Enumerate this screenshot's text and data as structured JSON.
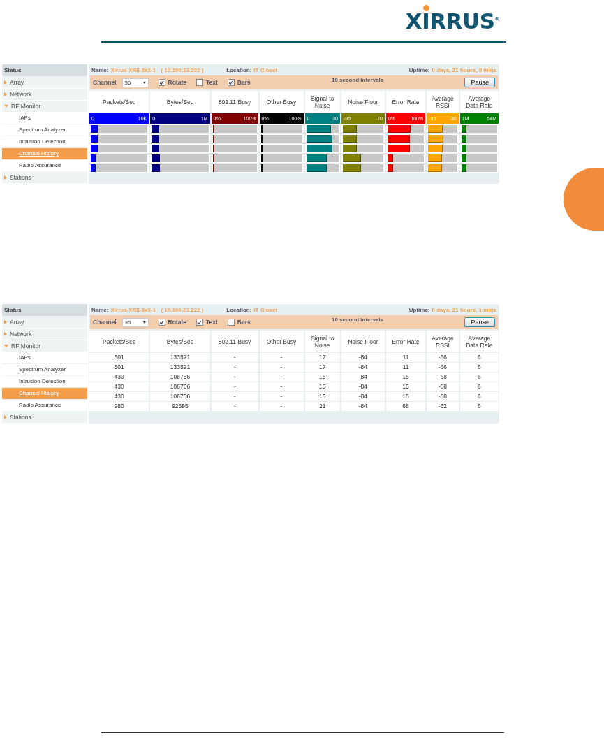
{
  "logo": {
    "text": "XIRRUS",
    "mark": "®"
  },
  "panels": [
    {
      "kind": "bars",
      "sidebar": {
        "title": "Status",
        "items": [
          {
            "label": "Array",
            "kind": "section",
            "expanded": false
          },
          {
            "label": "Network",
            "kind": "section",
            "expanded": false
          },
          {
            "label": "RF Monitor",
            "kind": "section",
            "expanded": true
          },
          {
            "label": "IAPs",
            "kind": "page",
            "selected": false
          },
          {
            "label": "Spectrum Analyzer",
            "kind": "page",
            "selected": false
          },
          {
            "label": "Intrusion Detection",
            "kind": "page",
            "selected": false
          },
          {
            "label": "Channel History",
            "kind": "page",
            "selected": true
          },
          {
            "label": "Radio Assurance",
            "kind": "page",
            "selected": false
          },
          {
            "label": "Stations",
            "kind": "section",
            "expanded": false
          }
        ]
      },
      "header": {
        "name_label": "Name:",
        "name": "Xirrus-XR8-3x3-1",
        "ip": "( 10.100.23.222 )",
        "location_label": "Location:",
        "location": "IT Closet",
        "uptime_label": "Uptime:",
        "uptime": "0 days, 21 hours, 0 mins"
      },
      "toolbar": {
        "channel_label": "Channel",
        "channel": "36",
        "options": [
          {
            "label": "Rotate",
            "checked": true
          },
          {
            "label": "Text",
            "checked": false
          },
          {
            "label": "Bars",
            "checked": true
          }
        ],
        "interval": "10 second intervals",
        "button": "Pause"
      },
      "columns": [
        "Packets/Sec",
        "Bytes/Sec",
        "802.11 Busy",
        "Other Busy",
        "Signal to Noise",
        "Noise Floor",
        "Error Rate",
        "Average RSSI",
        "Average Data Rate"
      ],
      "scales": [
        {
          "min": "0",
          "max": "10K",
          "color": "#0000ff"
        },
        {
          "min": "0",
          "max": "1M",
          "color": "#000080"
        },
        {
          "min": "0%",
          "max": "100%",
          "color": "#800000"
        },
        {
          "min": "0%",
          "max": "100%",
          "color": "#000000"
        },
        {
          "min": "0",
          "max": "30",
          "color": "#008080"
        },
        {
          "min": "-95",
          "max": "-70",
          "color": "#808000"
        },
        {
          "min": "0%",
          "max": "100%",
          "color": "#ff0000"
        },
        {
          "min": "-95",
          "max": "-30",
          "color": "#ffa500"
        },
        {
          "min": "1M",
          "max": "54M",
          "color": "#008000"
        }
      ],
      "rows": [
        {
          "cells": [
            {
              "level": 0.12
            },
            {
              "level": 0.13
            },
            {
              "level": 0.03
            },
            {
              "level": 0.02
            },
            {
              "level": 0.76
            },
            {
              "level": 0.35
            },
            {
              "level": 0.64
            },
            {
              "level": 0.49
            },
            {
              "level": 0.15
            }
          ]
        },
        {
          "cells": [
            {
              "level": 0.12
            },
            {
              "level": 0.13
            },
            {
              "level": 0.03
            },
            {
              "level": 0.02
            },
            {
              "level": 0.8
            },
            {
              "level": 0.35
            },
            {
              "level": 0.62
            },
            {
              "level": 0.52
            },
            {
              "level": 0.15
            }
          ]
        },
        {
          "cells": [
            {
              "level": 0.12
            },
            {
              "level": 0.13
            },
            {
              "level": 0.03
            },
            {
              "level": 0.02
            },
            {
              "level": 0.8
            },
            {
              "level": 0.35
            },
            {
              "level": 0.62
            },
            {
              "level": 0.49
            },
            {
              "level": 0.15
            }
          ]
        },
        {
          "cells": [
            {
              "level": 0.08
            },
            {
              "level": 0.15
            },
            {
              "level": 0.03
            },
            {
              "level": 0.02
            },
            {
              "level": 0.64
            },
            {
              "level": 0.45
            },
            {
              "level": 0.16
            },
            {
              "level": 0.48
            },
            {
              "level": 0.15
            }
          ]
        },
        {
          "cells": [
            {
              "level": 0.08
            },
            {
              "level": 0.15
            },
            {
              "level": 0.03
            },
            {
              "level": 0.02
            },
            {
              "level": 0.64
            },
            {
              "level": 0.45
            },
            {
              "level": 0.16
            },
            {
              "level": 0.48
            },
            {
              "level": 0.15
            }
          ]
        }
      ]
    },
    {
      "kind": "text",
      "sidebar": {
        "title": "Status",
        "items": [
          {
            "label": "Array",
            "kind": "section",
            "expanded": false
          },
          {
            "label": "Network",
            "kind": "section",
            "expanded": false
          },
          {
            "label": "RF Monitor",
            "kind": "section",
            "expanded": true
          },
          {
            "label": "IAPs",
            "kind": "page",
            "selected": false
          },
          {
            "label": "Spectrum Analyzer",
            "kind": "page",
            "selected": false
          },
          {
            "label": "Intrusion Detection",
            "kind": "page",
            "selected": false
          },
          {
            "label": "Channel History",
            "kind": "page",
            "selected": true
          },
          {
            "label": "Radio Assurance",
            "kind": "page",
            "selected": false
          },
          {
            "label": "Stations",
            "kind": "section",
            "expanded": false
          }
        ]
      },
      "header": {
        "name_label": "Name:",
        "name": "Xirrus-XR8-3x3-1",
        "ip": "( 10.100.23.222 )",
        "location_label": "Location:",
        "location": "IT Closet",
        "uptime_label": "Uptime:",
        "uptime": "0 days, 21 hours, 1 mins"
      },
      "toolbar": {
        "channel_label": "Channel",
        "channel": "36",
        "options": [
          {
            "label": "Rotate",
            "checked": true
          },
          {
            "label": "Text",
            "checked": true
          },
          {
            "label": "Bars",
            "checked": false
          }
        ],
        "interval": "10 second intervals",
        "button": "Pause"
      },
      "columns": [
        "Packets/Sec",
        "Bytes/Sec",
        "802.11 Busy",
        "Other Busy",
        "Signal to Noise",
        "Noise Floor",
        "Error Rate",
        "Average RSSI",
        "Average Data Rate"
      ],
      "rows": [
        {
          "cells": [
            "501",
            "133521",
            "-",
            "-",
            "17",
            "-84",
            "11",
            "-66",
            "6"
          ]
        },
        {
          "cells": [
            "501",
            "133521",
            "-",
            "-",
            "17",
            "-84",
            "11",
            "-66",
            "6"
          ]
        },
        {
          "cells": [
            "430",
            "106756",
            "-",
            "-",
            "15",
            "-84",
            "15",
            "-68",
            "6"
          ]
        },
        {
          "cells": [
            "430",
            "106756",
            "-",
            "-",
            "15",
            "-84",
            "15",
            "-68",
            "6"
          ]
        },
        {
          "cells": [
            "430",
            "106756",
            "-",
            "-",
            "15",
            "-84",
            "15",
            "-68",
            "6"
          ]
        },
        {
          "cells": [
            "980",
            "92695",
            "-",
            "-",
            "21",
            "-84",
            "68",
            "-62",
            "6"
          ]
        }
      ]
    }
  ]
}
